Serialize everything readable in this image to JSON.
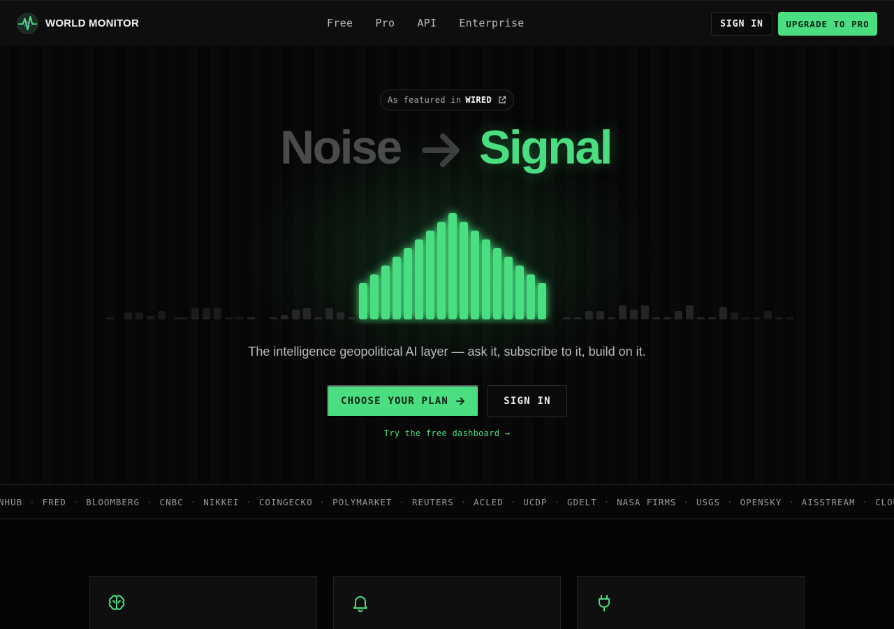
{
  "brand": {
    "name": "WORLD MONITOR"
  },
  "nav": {
    "links": [
      "Free",
      "Pro",
      "API",
      "Enterprise"
    ],
    "sign_in": "SIGN IN",
    "upgrade": "UPGRADE TO PRO"
  },
  "hero": {
    "featured_prefix": "As featured in",
    "featured_brand": "WIRED",
    "headline_noise": "Noise",
    "headline_signal": "Signal",
    "tagline": "The intelligence geopolitical AI layer — ask it, subscribe to it, build on it.",
    "cta_primary": "CHOOSE YOUR PLAN",
    "cta_secondary": "SIGN IN",
    "free_link": "Try the free dashboard →"
  },
  "ticker": {
    "items": [
      "NHUB",
      "FRED",
      "BLOOMBERG",
      "CNBC",
      "NIKKEI",
      "COINGECKO",
      "POLYMARKET",
      "REUTERS",
      "ACLED",
      "UCDP",
      "GDELT",
      "NASA FIRMS",
      "USGS",
      "OPENSKY",
      "AISSTREAM",
      "CLOUDFLARE"
    ]
  },
  "features": {
    "icons": [
      "brain-icon",
      "bell-icon",
      "plug-icon"
    ]
  },
  "colors": {
    "accent": "#4ade80",
    "noise": "#4a4c4b",
    "background": "#050505"
  }
}
